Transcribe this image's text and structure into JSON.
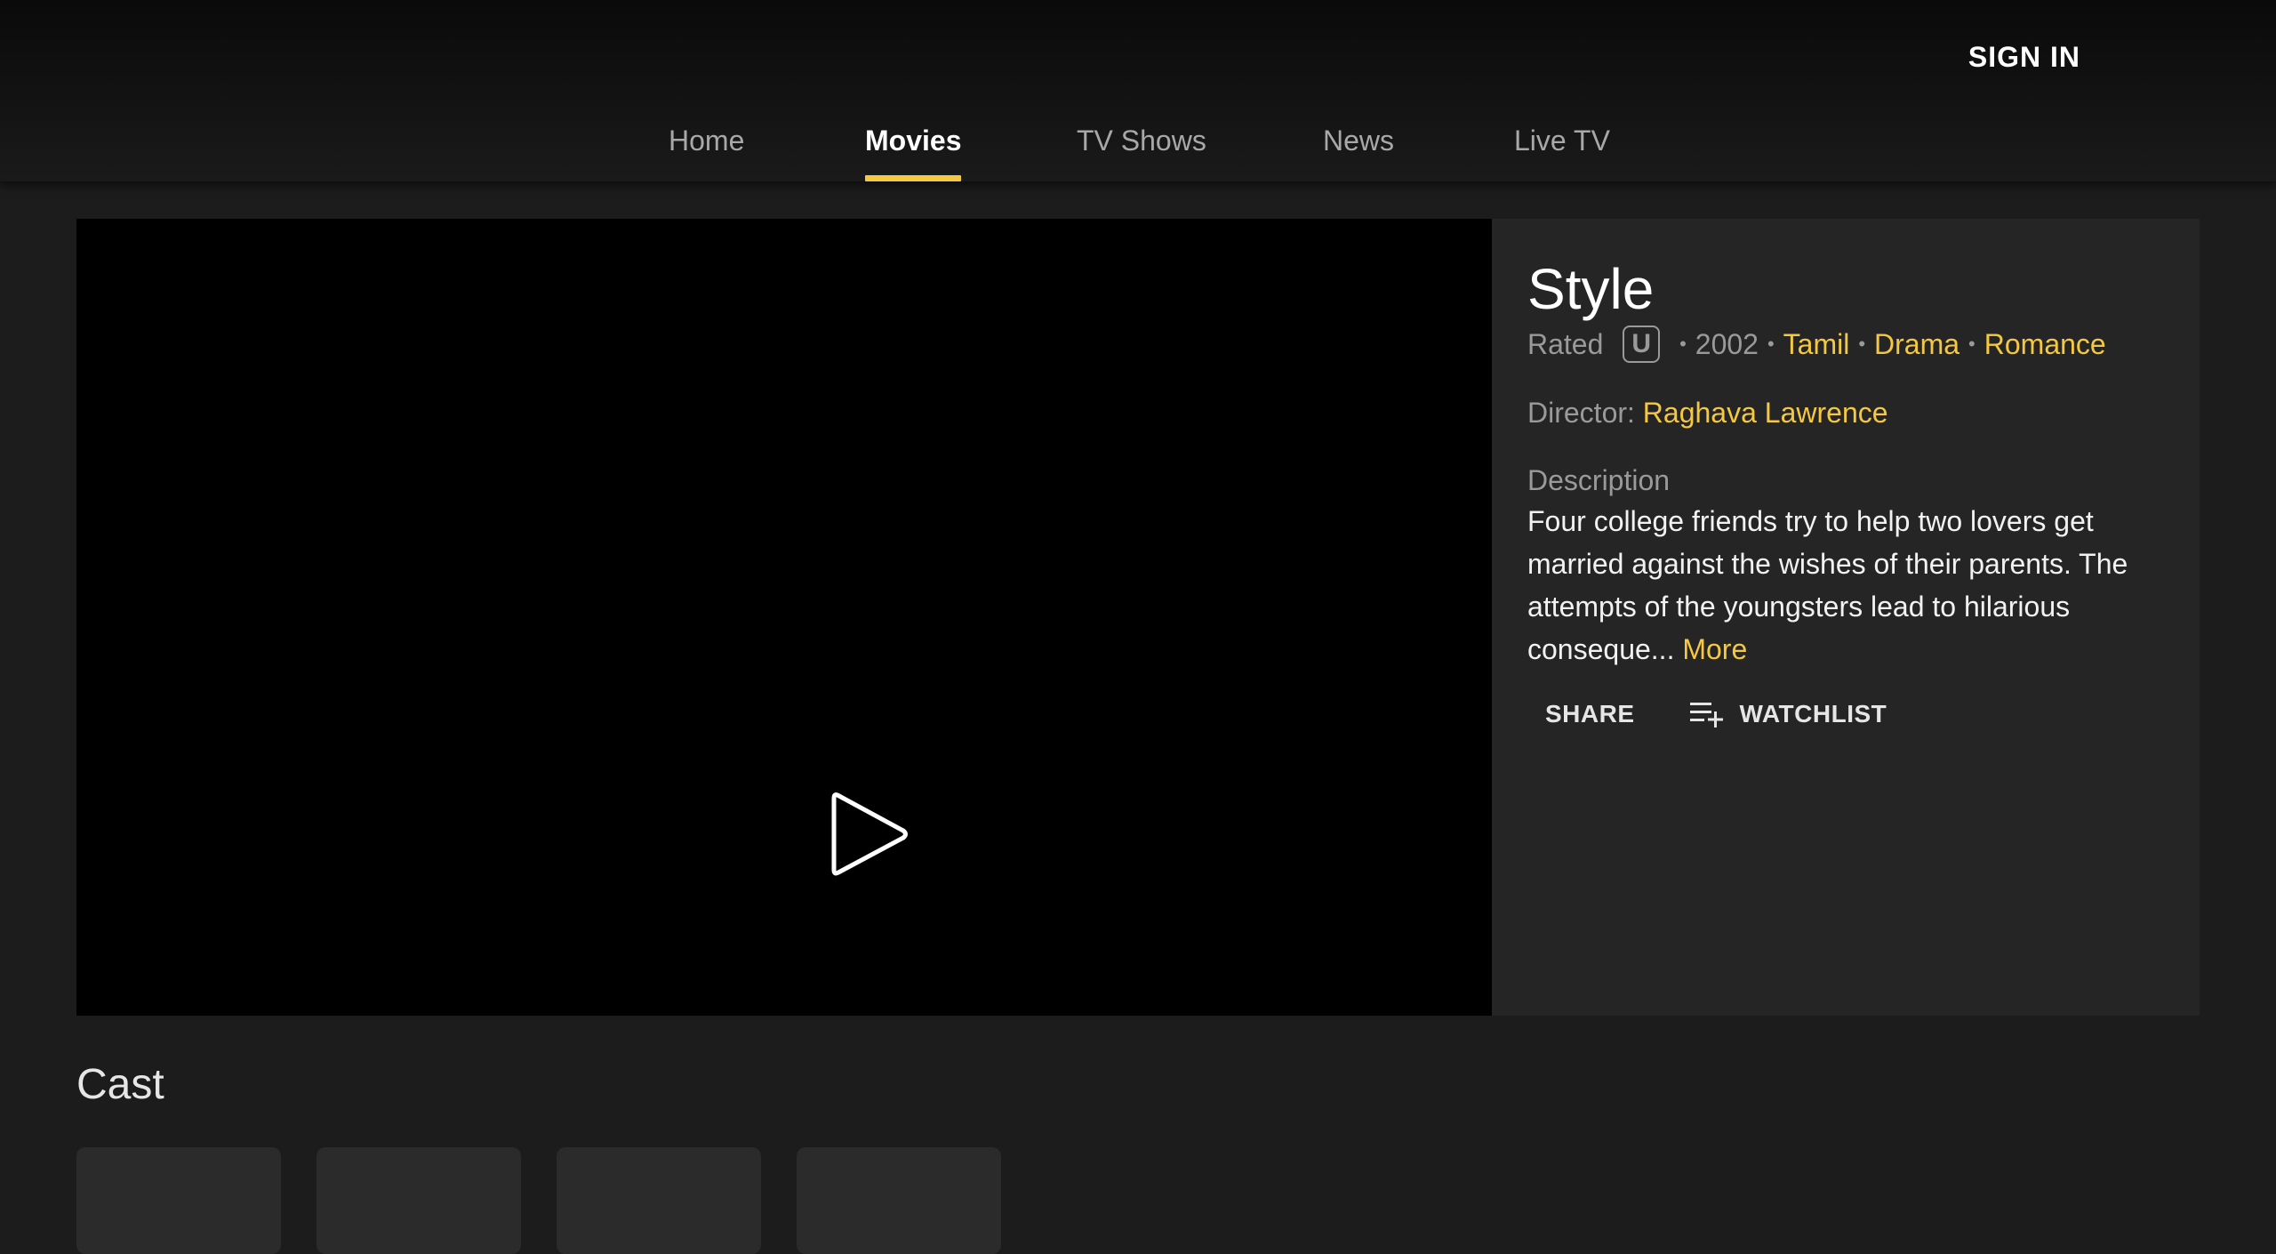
{
  "header": {
    "sign_in_label": "SIGN IN",
    "nav": [
      {
        "label": "Home",
        "active": false
      },
      {
        "label": "Movies",
        "active": true
      },
      {
        "label": "TV Shows",
        "active": false
      },
      {
        "label": "News",
        "active": false
      },
      {
        "label": "Live TV",
        "active": false
      }
    ]
  },
  "player": {
    "icon": "play-icon"
  },
  "movie": {
    "title": "Style",
    "rated_label": "Rated",
    "rating": "U",
    "year": "2002",
    "language": "Tamil",
    "genres": [
      "Drama",
      "Romance"
    ],
    "director_label": "Director:",
    "director": "Raghava Lawrence",
    "description_label": "Description",
    "description": "Four college friends try to help two lovers get married against the wishes of their parents. The attempts of the youngsters lead to hilarious conseque...",
    "more_label": "More"
  },
  "actions": {
    "share_label": "SHARE",
    "watchlist_label": "WATCHLIST",
    "watchlist_icon": "playlist-add-icon"
  },
  "cast": {
    "title": "Cast",
    "count_visible": 4
  },
  "colors": {
    "accent": "#f5c842",
    "background": "#1c1c1c",
    "panel": "#252525"
  }
}
